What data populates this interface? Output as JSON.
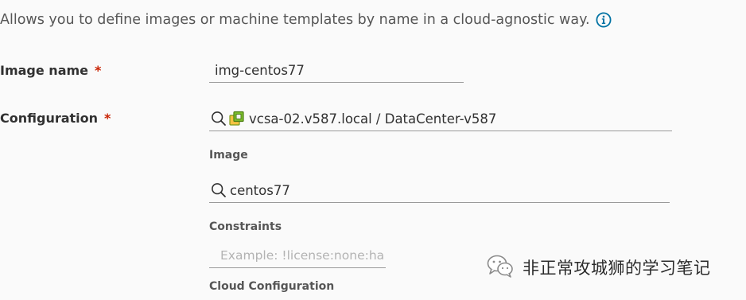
{
  "description": {
    "text": "Allows you to define images or machine templates by name in a cloud-agnostic way.",
    "icon": "info-circle-icon"
  },
  "image_name": {
    "label": "Image name",
    "required_marker": "*",
    "value": "img-centos77"
  },
  "configuration": {
    "label": "Configuration",
    "required_marker": "*",
    "value": "vcsa-02.v587.local / DataCenter-v587",
    "icons": [
      "search-icon",
      "vcenter-datacenter-icon"
    ]
  },
  "image": {
    "label": "Image",
    "value": "centos77",
    "icon": "search-icon"
  },
  "constraints": {
    "label": "Constraints",
    "placeholder": "Example: !license:none:ha"
  },
  "cloud_configuration": {
    "label": "Cloud Configuration"
  },
  "watermark": {
    "text": "非正常攻城狮的学习笔记",
    "icon": "wechat-icon"
  },
  "colors": {
    "info_blue": "#0072a3",
    "required_red": "#c92100",
    "vc_green": "#62a420",
    "vc_orange": "#f39c12"
  }
}
